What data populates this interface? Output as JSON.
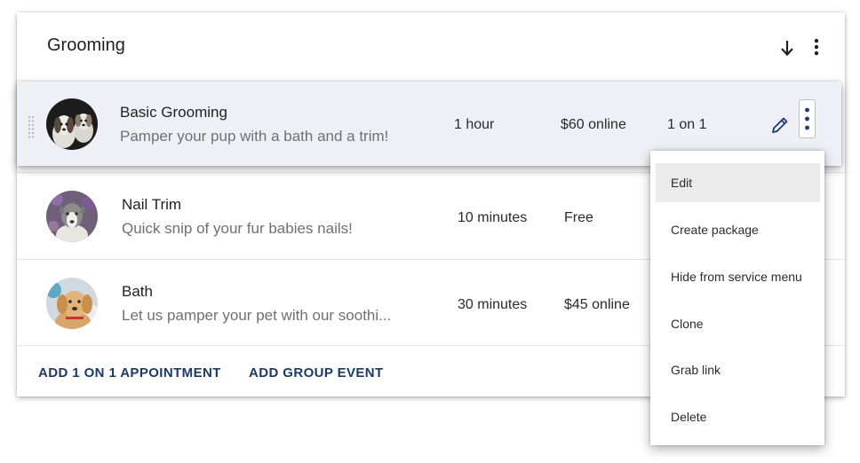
{
  "header": {
    "title": "Grooming",
    "sort_icon": "arrow-down-icon",
    "more_icon": "vertical-ellipsis-icon"
  },
  "services": [
    {
      "name": "Basic Grooming",
      "description": "Pamper your pup with a bath and a trim!",
      "duration": "1 hour",
      "price": "$60 online",
      "type": "1 on 1",
      "avatar": "two-dogs-photo"
    },
    {
      "name": "Nail Trim",
      "description": "Quick snip of your fur babies nails!",
      "duration": "10 minutes",
      "price": "Free",
      "avatar": "pitbull-dog-photo"
    },
    {
      "name": "Bath",
      "description": "Let us pamper your pet with our soothi...",
      "duration": "30 minutes",
      "price": "$45 online",
      "avatar": "golden-puppy-photo"
    }
  ],
  "row_actions": {
    "edit_icon": "pencil-icon",
    "more_icon": "vertical-ellipsis-icon"
  },
  "context_menu": {
    "items": [
      "Edit",
      "Create package",
      "Hide from service menu",
      "Clone",
      "Grab link",
      "Delete"
    ],
    "selected": "Edit"
  },
  "footer": {
    "add_appointment": "ADD 1 ON 1 APPOINTMENT",
    "add_group_event": "ADD GROUP EVENT"
  },
  "colors": {
    "accent_link": "#1b3a67",
    "active_row_bg": "#eef0f6",
    "icon_blue": "#1e3a6e"
  }
}
